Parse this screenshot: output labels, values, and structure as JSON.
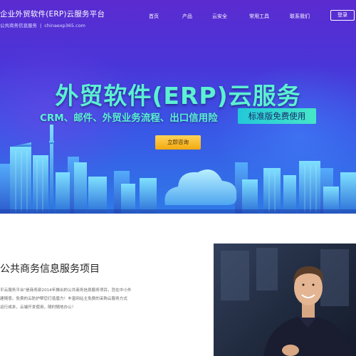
{
  "header": {
    "brand_title": "企业外贸软件(ERP)云服务平台",
    "brand_subtitle": "公共商务信息服务",
    "brand_domain": "chinaexp365.com",
    "nav": [
      {
        "label": "首页"
      },
      {
        "label": "产品"
      },
      {
        "label": "云安全"
      },
      {
        "label": "常用工具"
      },
      {
        "label": "联系我们"
      }
    ],
    "login_label": "登录"
  },
  "hero": {
    "headline": "外贸软件(ERP)云服务",
    "subline": "CRM、邮件、外贸业务流程、出口信用险",
    "badge": "标准版免费使用",
    "cta_label": "立即咨询"
  },
  "section": {
    "title": "公共商务信息服务项目",
    "paragraph_lines": [
      "平云服务平台\"是商务部2014年推出的公共商务信息服务项目，旨在中小外",
      "建随意。免费的云防护帮您打造盾力！丰富网站主免费的采购云服务方式",
      "运行成本，云端开发使用，随时随地办公！"
    ]
  },
  "colors": {
    "hero_accent": "#5cf1d2",
    "badge_bg": "#2fd6d0",
    "cta_bg": "#f5b323",
    "hero_top": "#5b2bd0",
    "hero_bottom": "#2f7be8"
  },
  "icons": {
    "video": "presenter-video-thumbnail"
  }
}
